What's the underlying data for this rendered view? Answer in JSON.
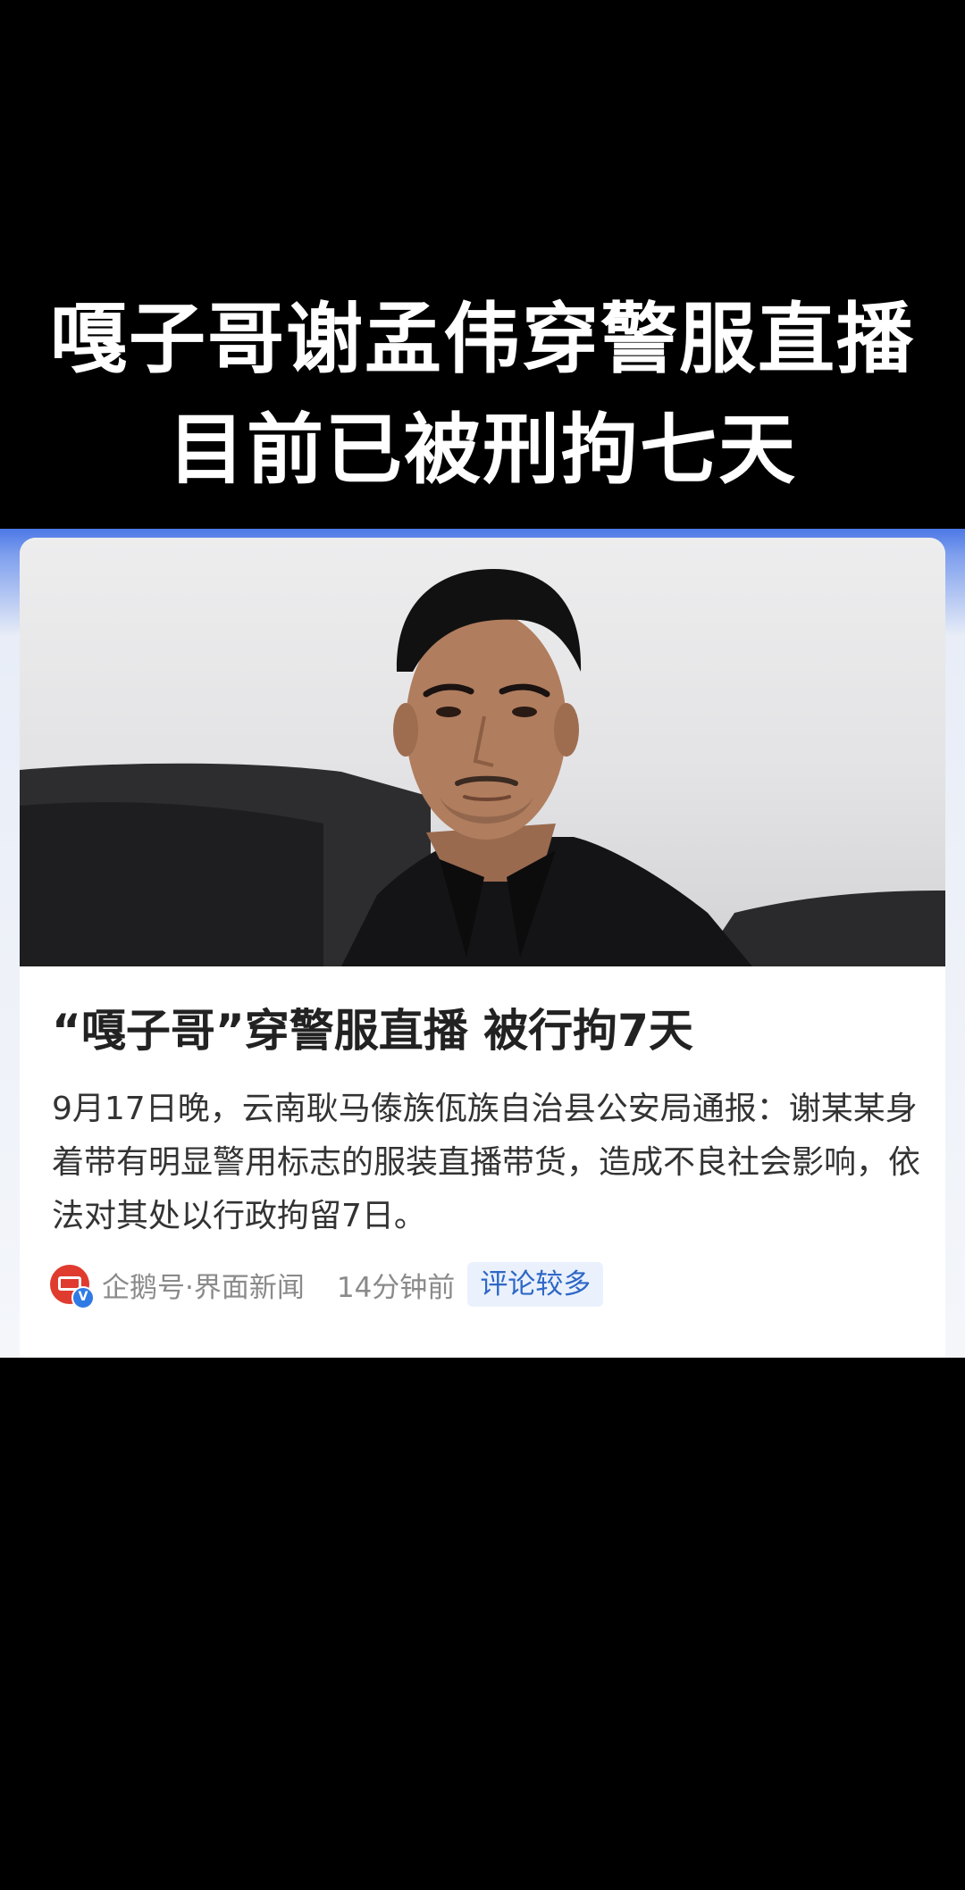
{
  "banner": {
    "title_line1": "嘎子哥谢孟伟穿警服直播",
    "title_line2": "目前已被刑拘七天"
  },
  "article": {
    "headline": "“嘎子哥”穿警服直播 被行拘7天",
    "summary": "9月17日晚，云南耿马傣族佤族自治县公安局通报：谢某某身着带有明显警用标志的服装直播带货，造成不良社会影响，依法对其处以行政拘留7日。",
    "source": "企鹅号·界面新闻",
    "time": "14分钟前",
    "comment_badge": "评论较多",
    "verified_mark": "V"
  },
  "colors": {
    "accent_blue": "#4d78e6",
    "badge_text": "#2e68c6",
    "source_logo": "#e03b2f"
  },
  "icons": {
    "source_logo": "jiemian-logo-icon",
    "verified": "verified-badge-icon"
  }
}
